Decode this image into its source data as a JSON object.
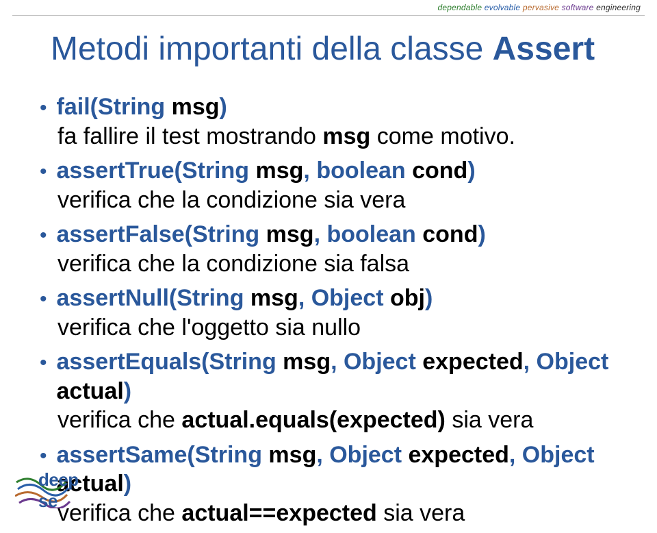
{
  "tagline": {
    "w1": "dependable",
    "w2": "evolvable",
    "w3": "pervasive",
    "w4": "software",
    "w5": "engineering"
  },
  "title": {
    "pre": "Metodi importanti della classe ",
    "bold": "Assert"
  },
  "items": [
    {
      "sig_parts": [
        "fail(String ",
        "msg",
        ")"
      ],
      "desc_parts": [
        "fa fallire il test mostrando ",
        "msg",
        " come motivo."
      ]
    },
    {
      "sig_parts": [
        "assertTrue(String ",
        "msg",
        ", boolean ",
        "cond",
        ")"
      ],
      "desc_parts": [
        "verifica che la condizione sia vera"
      ]
    },
    {
      "sig_parts": [
        "assertFalse(String ",
        "msg",
        ", boolean ",
        "cond",
        ")"
      ],
      "desc_parts": [
        "verifica che la condizione sia falsa"
      ]
    },
    {
      "sig_parts": [
        "assertNull(String ",
        "msg",
        ", Object ",
        "obj",
        ")"
      ],
      "desc_parts": [
        "verifica che l'oggetto sia nullo"
      ]
    },
    {
      "sig_parts": [
        "assertEquals(String ",
        "msg",
        ", Object ",
        "expected",
        ", Object ",
        "actual",
        ")"
      ],
      "desc_parts": [
        "verifica che ",
        "actual.equals(expected)",
        " sia vera"
      ]
    },
    {
      "sig_parts": [
        "assertSame(String ",
        "msg",
        ", Object ",
        "expected",
        ", Object ",
        "actual",
        ")"
      ],
      "desc_parts": [
        "verifica che ",
        "actual==expected",
        " sia vera"
      ]
    }
  ],
  "logo_text": "deep se",
  "colors": {
    "accent": "#2a589b"
  }
}
